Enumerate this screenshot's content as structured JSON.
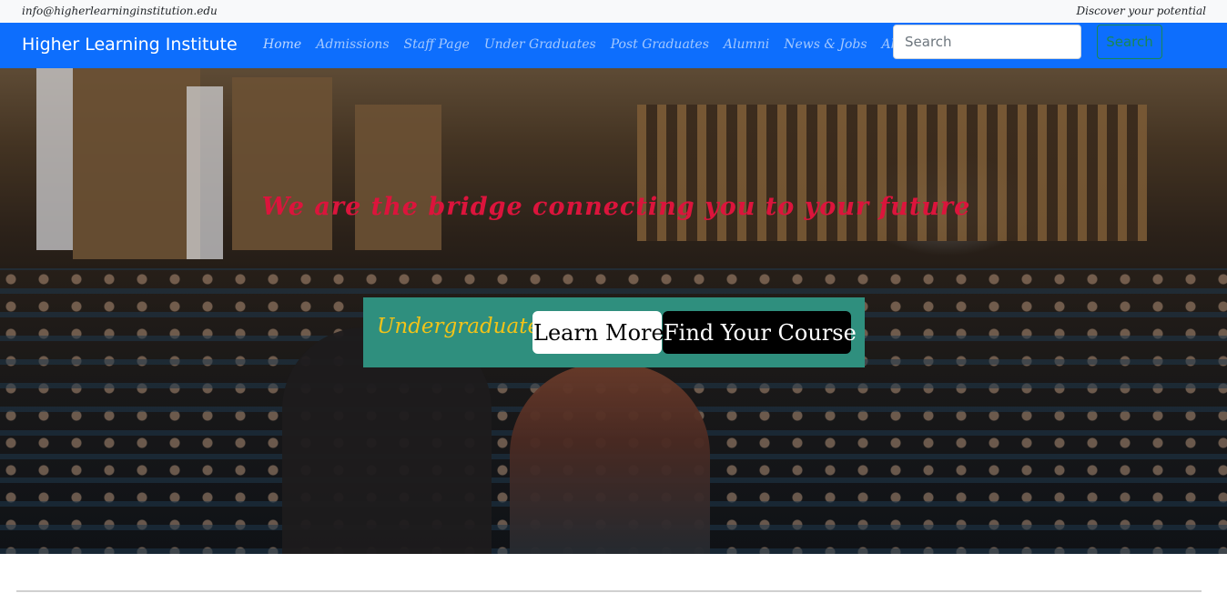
{
  "topbar": {
    "email": "info@higherlearninginstitution.edu",
    "tagline": "Discover your potential"
  },
  "navbar": {
    "brand": "Higher Learning Institute",
    "links": [
      {
        "label": "Home"
      },
      {
        "label": "Admissions"
      },
      {
        "label": "Staff Page"
      },
      {
        "label": "Under Graduates"
      },
      {
        "label": "Post Graduates"
      },
      {
        "label": "Alumni"
      },
      {
        "label": "News & Jobs"
      },
      {
        "label": "About Us"
      }
    ],
    "search": {
      "placeholder": "Search",
      "button_label": "Search"
    }
  },
  "hero": {
    "heading": "We are the bridge connecting you to your future",
    "cta": {
      "label": "Undergraduate",
      "learn_more": "Learn More",
      "find_course": "Find Your Course"
    }
  },
  "colors": {
    "navbar_bg": "#0d6efd",
    "heading": "#dc143c",
    "cta_bg": "#2f8f7e",
    "cta_label": "#f2c318",
    "search_button": "#198754"
  }
}
